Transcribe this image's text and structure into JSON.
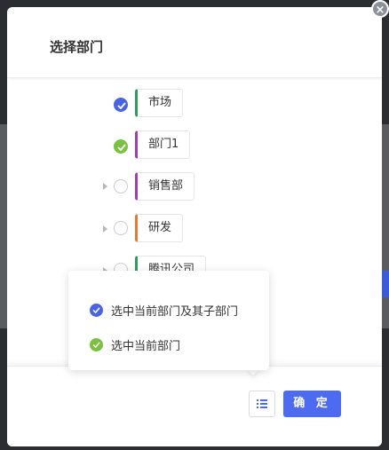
{
  "dialog": {
    "title": "选择部门",
    "close_symbol": "×",
    "confirm_label": "确 定",
    "list_icon": "list-icon"
  },
  "tree": {
    "nodes": [
      {
        "label": "市场",
        "state": "checked-blue",
        "has_children": false,
        "tag_color": "#2aa15a"
      },
      {
        "label": "部门1",
        "state": "checked-green",
        "has_children": false,
        "tag_color": "#a43ab4"
      },
      {
        "label": "销售部",
        "state": "unchecked",
        "has_children": true,
        "tag_color": "#a43ab4"
      },
      {
        "label": "研发",
        "state": "unchecked",
        "has_children": true,
        "tag_color": "#e97a2a"
      },
      {
        "label": "腾讯公司",
        "state": "unchecked",
        "has_children": true,
        "tag_color": "#2aa15a"
      }
    ]
  },
  "popover": {
    "options": [
      {
        "label": "选中当前部门及其子部门",
        "color": "#4a63e3"
      },
      {
        "label": "选中当前部门",
        "color": "#79c13e"
      }
    ]
  },
  "colors": {
    "primary": "#4d6bf0",
    "blue_check": "#4a63e3",
    "green_check": "#79c13e"
  }
}
